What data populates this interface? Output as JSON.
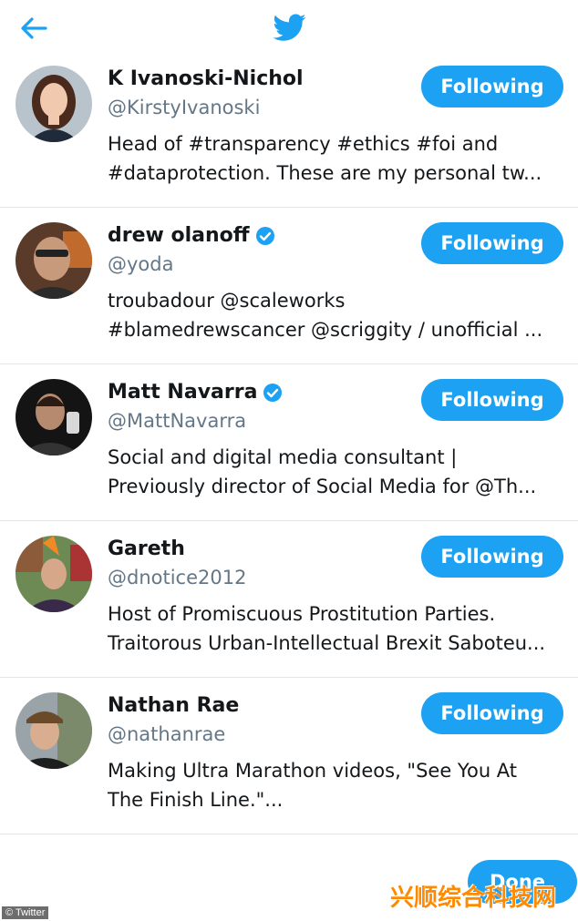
{
  "header": {
    "back_icon": "arrow-left-icon",
    "logo_icon": "twitter-bird-icon",
    "accent_color": "#1da1f2"
  },
  "users": [
    {
      "name": "K Ivanoski-Nichol",
      "verified": false,
      "handle": "@KirstyIvanoski",
      "bio_line1": "Head of #transparency #ethics #foi and",
      "bio_line2": "#dataprotection. These are my personal tw...",
      "button_label": "Following"
    },
    {
      "name": "drew olanoff",
      "verified": true,
      "handle": "@yoda",
      "bio_line1": "troubadour @scaleworks",
      "bio_line2": "#blamedrewscancer @scriggity / unofficial ...",
      "button_label": "Following"
    },
    {
      "name": "Matt Navarra",
      "verified": true,
      "handle": "@MattNavarra",
      "bio_line1": "Social and digital media consultant |",
      "bio_line2": "Previously director of Social Media for @Th...",
      "button_label": "Following"
    },
    {
      "name": "Gareth",
      "verified": false,
      "handle": "@dnotice2012",
      "bio_line1": "Host of Promiscuous Prostitution Parties.",
      "bio_line2": "Traitorous Urban-Intellectual Brexit Saboteu...",
      "button_label": "Following"
    },
    {
      "name": "Nathan Rae",
      "verified": false,
      "handle": "@nathanrae",
      "bio_line1": "Making Ultra Marathon videos, \"See You At",
      "bio_line2": "The Finish Line.\"...",
      "button_label": "Following"
    }
  ],
  "footer": {
    "done_label": "Done"
  },
  "watermarks": {
    "left": "© Twitter",
    "right": "兴顺综合科技网"
  }
}
